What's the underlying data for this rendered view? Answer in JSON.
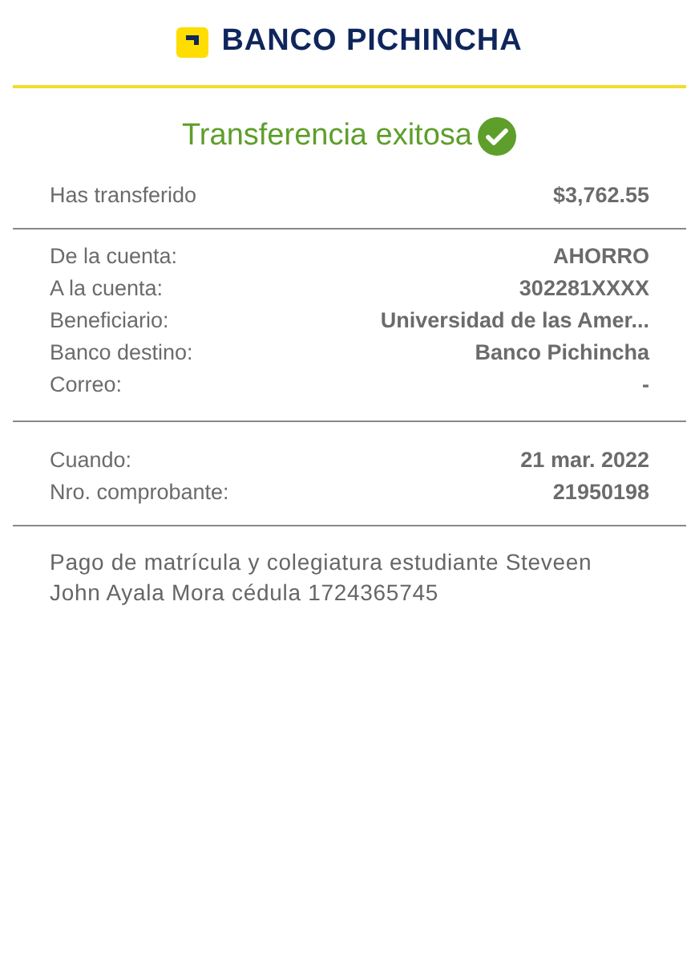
{
  "header": {
    "brand": "BANCO PICHINCHA"
  },
  "title": "Transferencia exitosa",
  "amount": {
    "label": "Has transferido",
    "value": "$3,762.55"
  },
  "details": [
    {
      "label": "De la cuenta:",
      "value": "AHORRO"
    },
    {
      "label": "A la cuenta:",
      "value": "302281XXXX"
    },
    {
      "label": "Beneficiario:",
      "value": "Universidad de las Amer..."
    },
    {
      "label": "Banco destino:",
      "value": "Banco Pichincha"
    },
    {
      "label": "Correo:",
      "value": "-"
    }
  ],
  "receipt": [
    {
      "label": "Cuando:",
      "value": "21 mar. 2022"
    },
    {
      "label": "Nro. comprobante:",
      "value": "21950198"
    }
  ],
  "note": "Pago de matrícula y colegiatura estudiante Steveen John Ayala Mora cédula 1724365745"
}
